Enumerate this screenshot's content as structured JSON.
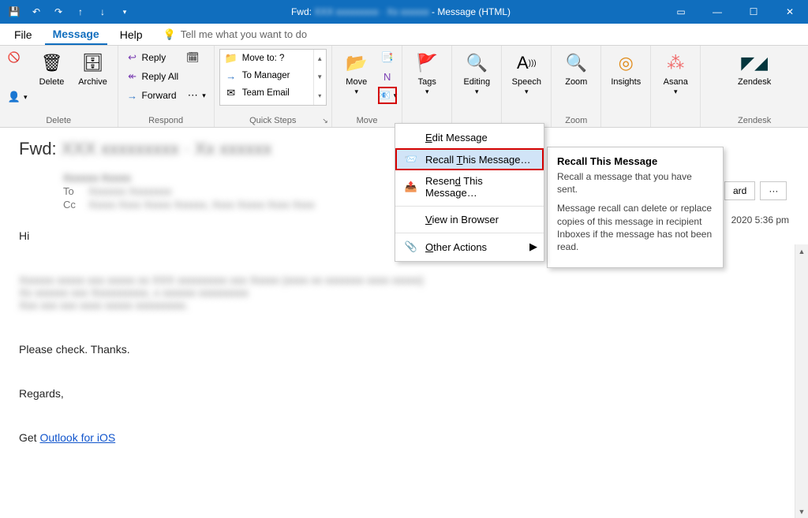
{
  "titlebar": {
    "title_prefix": "Fwd:",
    "title_subject_blurred": "XXX xxxxxxxxx · Xx xxxxxx",
    "title_suffix": " - Message (HTML)"
  },
  "ribbon_tabs": {
    "file": "File",
    "message": "Message",
    "help": "Help",
    "tellme": "Tell me what you want to do"
  },
  "groups": {
    "delete": {
      "label": "Delete",
      "delete": "Delete",
      "archive": "Archive"
    },
    "respond": {
      "label": "Respond",
      "reply": "Reply",
      "reply_all": "Reply All",
      "forward": "Forward"
    },
    "quicksteps": {
      "label": "Quick Steps",
      "move_to": "Move to: ?",
      "to_manager": "To Manager",
      "team_email": "Team Email"
    },
    "move": {
      "label": "Move",
      "move_btn": "Move"
    },
    "tags": {
      "label": "Tags"
    },
    "editing": {
      "label": "Editing"
    },
    "speech": {
      "label": "Speech"
    },
    "zoom": {
      "label": "Zoom",
      "zoom_btn": "Zoom"
    },
    "insights": {
      "label": "Insights"
    },
    "asana": {
      "label": "Asana"
    },
    "zendesk": {
      "label": "Zendesk"
    }
  },
  "menu": {
    "edit": "Edit Message",
    "recall": "Recall This Message…",
    "resend": "Resend This Message…",
    "view_browser": "View in Browser",
    "other": "Other Actions"
  },
  "tooltip": {
    "title": "Recall This Message",
    "line1": "Recall a message that you have sent.",
    "line2": "Message recall can delete or replace copies of this message in recipient Inboxes if the message has not been read."
  },
  "behind": {
    "forward_partial": "ard",
    "more": "···"
  },
  "timestamp": "2020 5:36 pm",
  "message": {
    "subject_prefix": "Fwd: ",
    "subject_blurred": "XXX xxxxxxxxx · Xx xxxxxx",
    "from_blurred": "Xxxxxx Xxxxx",
    "to_label": "To",
    "to_blurred": "Xxxxxxx  Xxxxxxxx",
    "cc_label": "Cc",
    "cc_blurred": "Xxxxx Xxxx Xxxxx Xxxxxx, Xxxx Xxxxx Xxxx Xxxx",
    "greeting": "Hi",
    "body_blurred_1": "Xxxxxx xxxxx xxx xxxxx xx XXX xxxxxxxxx xxx Xxxxx (xxxx xx xxxxxxx xxxx xxxxx)",
    "body_blurred_2": "Xx xxxxxx xxx Xxxxxxxxxx,  x xxxxxx xxxxxxxxx",
    "body_blurred_3": "Xxx xxx xxx xxxx xxxxx xxxxxxxxx.",
    "body_line": "Please check. Thanks.",
    "signoff": "Regards,",
    "signature_pre": "Get ",
    "signature_link": "Outlook for iOS"
  }
}
